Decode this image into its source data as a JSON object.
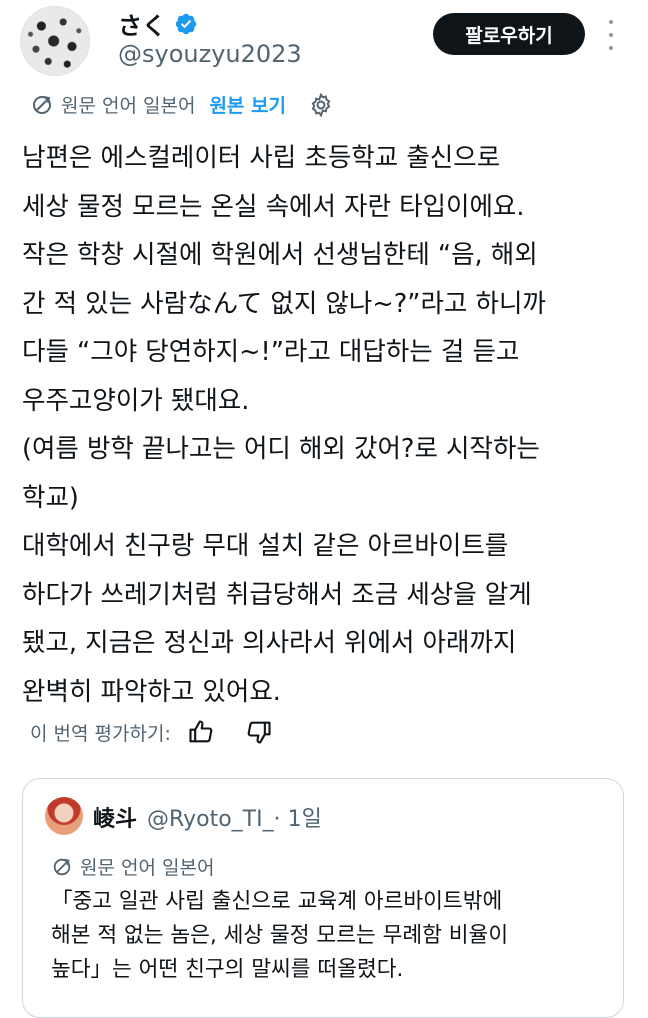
{
  "author": {
    "display_name": "さく",
    "handle": "@syouzyu2023",
    "follow_label": "팔로우하기"
  },
  "translation": {
    "original_language": "원문 언어 일본어",
    "show_original": "원본 보기"
  },
  "post_lines": [
    "남편은 에스컬레이터 사립 초등학교 출신으로",
    "세상 물정 모르는 온실 속에서 자란 타입이에요.",
    "작은 학창 시절에 학원에서 선생님한테 “음, 해외",
    "간 적 있는 사람なんて 없지 않나~?”라고 하니까",
    "다들 “그야 당연하지~!”라고 대답하는 걸 듣고",
    "우주고양이가 됐대요.",
    "(여름 방학 끝나고는 어디 해외 갔어?로 시작하는",
    "학교)",
    "대학에서 친구랑 무대 설치 같은 아르바이트를",
    "하다가 쓰레기처럼 취급당해서 조금 세상을 알게",
    "됐고, 지금은 정신과 의사라서 위에서 아래까지",
    "완벽히 파악하고 있어요."
  ],
  "rate": {
    "label": "이 번역 평가하기:"
  },
  "quote": {
    "display_name": "崚斗",
    "handle": "@Ryoto_TI_",
    "time": " · 1일",
    "translation_label": "원문 언어 일본어",
    "lines": [
      "「중고 일관 사립 출신으로 교육계 아르바이트밖에",
      "해본 적 없는 놈은, 세상 물정 모르는 무례함 비율이",
      "높다」는 어떤 친구의 말씨를 떠올렸다."
    ]
  },
  "icons": {
    "verified": "verified-badge-icon",
    "translate": "translate-icon",
    "settings": "gear-icon",
    "thumbs_up": "thumbs-up-icon",
    "thumbs_down": "thumbs-down-icon",
    "more": "more-vertical-icon"
  },
  "colors": {
    "accent": "#1d9bf0",
    "text": "#0f1419",
    "secondary": "#536471",
    "follow_button": "#0f1419"
  }
}
